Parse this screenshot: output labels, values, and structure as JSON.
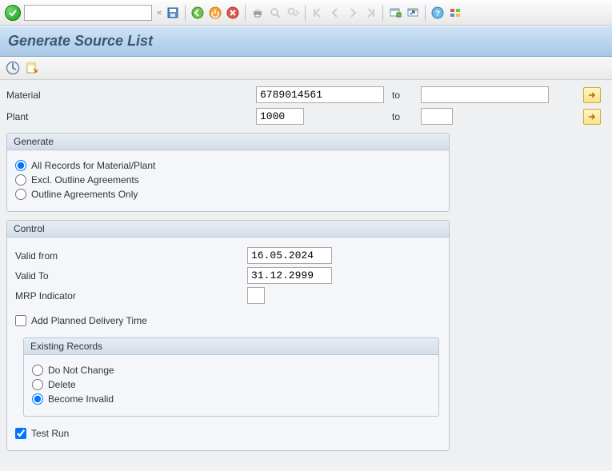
{
  "header": {
    "title": "Generate Source List"
  },
  "toolbar": {
    "command_placeholder": "",
    "command_value": "",
    "collapse": "«"
  },
  "selection": {
    "material": {
      "label": "Material",
      "from": "6789014561",
      "to_label": "to",
      "to": ""
    },
    "plant": {
      "label": "Plant",
      "from": "1000",
      "to_label": "to",
      "to": ""
    }
  },
  "generate": {
    "legend": "Generate",
    "options": {
      "all": "All Records for Material/Plant",
      "excl": "Excl. Outline Agreements",
      "only": "Outline Agreements Only"
    },
    "selected": "all"
  },
  "control": {
    "legend": "Control",
    "valid_from_label": "Valid from",
    "valid_from": "16.05.2024",
    "valid_to_label": "Valid To",
    "valid_to": "31.12.2999",
    "mrp_label": "MRP Indicator",
    "mrp": "",
    "add_planned_label": "Add Planned Delivery Time",
    "add_planned": false,
    "existing": {
      "legend": "Existing Records",
      "options": {
        "nochange": "Do Not Change",
        "delete": "Delete",
        "invalid": "Become Invalid"
      },
      "selected": "invalid"
    },
    "test_run_label": "Test Run",
    "test_run": true
  }
}
